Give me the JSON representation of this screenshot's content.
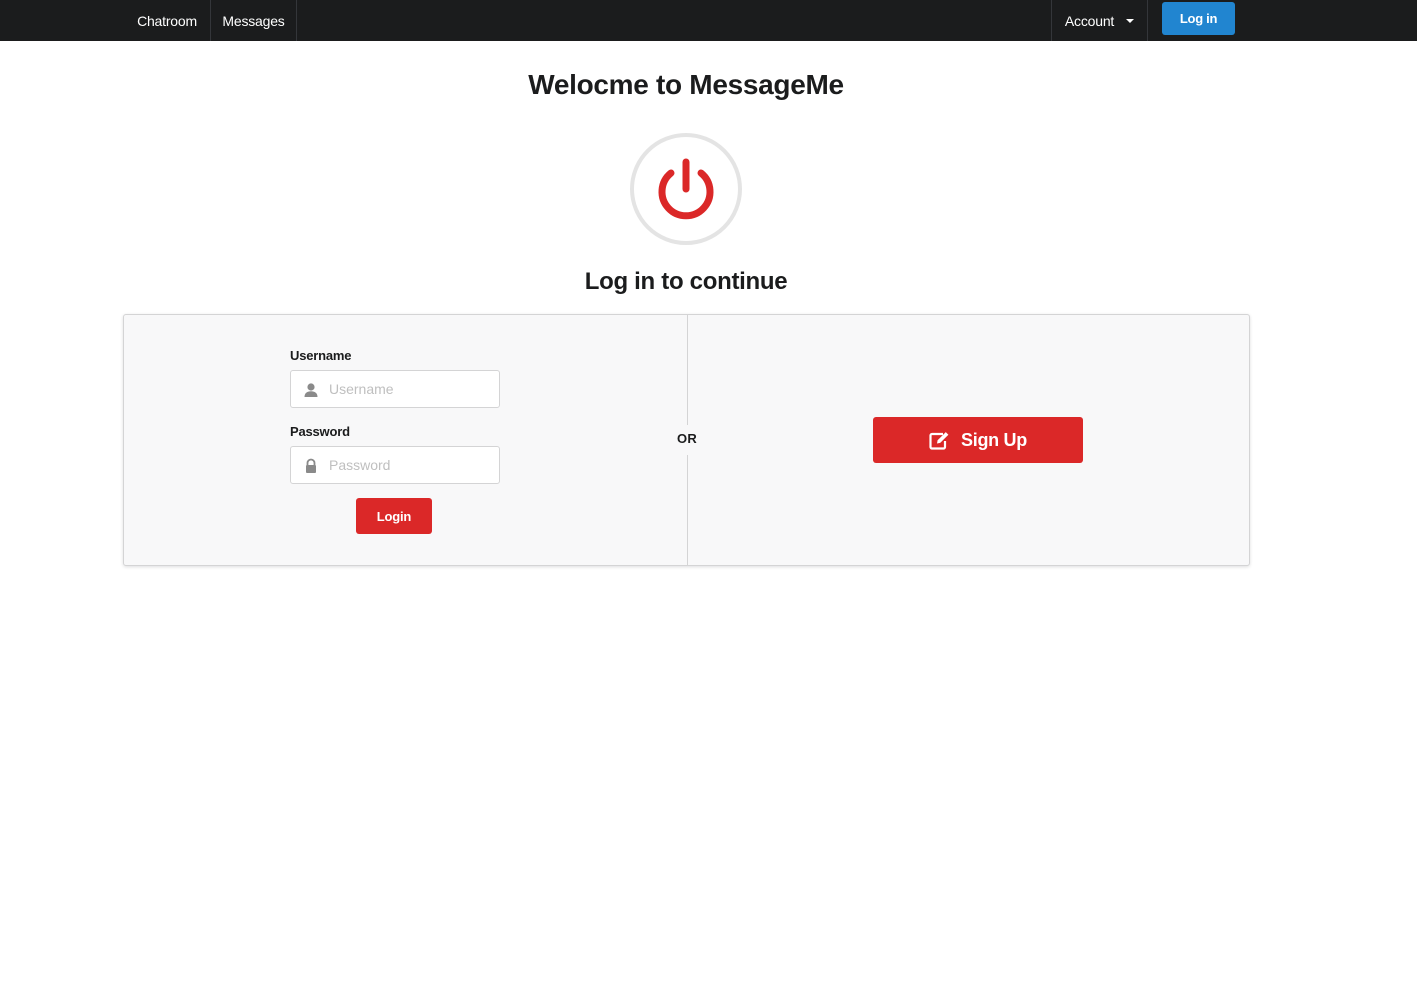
{
  "navbar": {
    "items": [
      {
        "label": "Chatroom"
      },
      {
        "label": "Messages"
      }
    ],
    "account_label": "Account",
    "login_label": "Log in"
  },
  "main": {
    "welcome_title": "Welocme to MessageMe",
    "subtitle": "Log in to continue",
    "icon": "power-icon"
  },
  "login_form": {
    "username_label": "Username",
    "username_placeholder": "Username",
    "username_value": "",
    "password_label": "Password",
    "password_placeholder": "Password",
    "password_value": "",
    "submit_label": "Login"
  },
  "divider_text": "OR",
  "signup": {
    "label": "Sign Up",
    "icon": "edit-icon"
  },
  "colors": {
    "navbar_bg": "#1b1c1d",
    "primary_blue": "#2185d0",
    "accent_red": "#db2828",
    "segment_bg": "#f8f8f9"
  }
}
